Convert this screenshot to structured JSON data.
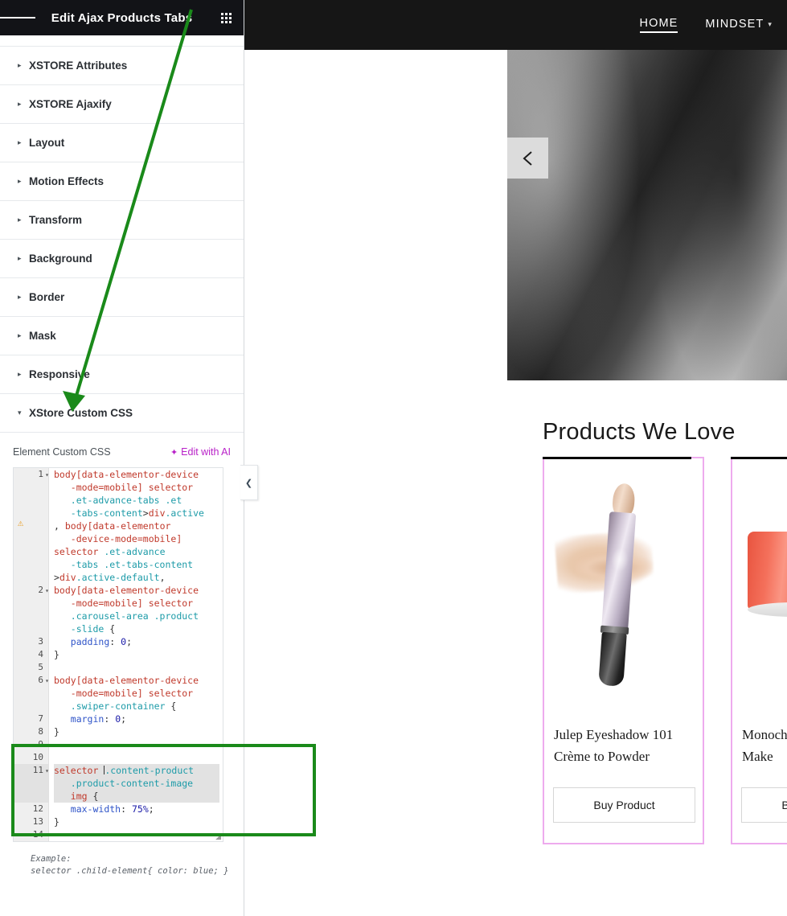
{
  "panel": {
    "title": "Edit Ajax Products Tabs",
    "menu_icon": "hamburger-icon",
    "apps_icon": "grid-icon",
    "sections": [
      {
        "label": "XSTORE Attributes",
        "expanded": false
      },
      {
        "label": "XSTORE Ajaxify",
        "expanded": false
      },
      {
        "label": "Layout",
        "expanded": false
      },
      {
        "label": "Motion Effects",
        "expanded": false
      },
      {
        "label": "Transform",
        "expanded": false
      },
      {
        "label": "Background",
        "expanded": false
      },
      {
        "label": "Border",
        "expanded": false
      },
      {
        "label": "Mask",
        "expanded": false
      },
      {
        "label": "Responsive",
        "expanded": false
      },
      {
        "label": "XStore Custom CSS",
        "expanded": true
      }
    ],
    "custom_css": {
      "field_label": "Element Custom CSS",
      "edit_with_ai": "Edit with AI",
      "warning_line": 1,
      "example_label": "Example:",
      "example_code": "selector .child-element{ color: blue; }",
      "lines": [
        {
          "n": "1",
          "fold": true
        },
        {
          "n": "2",
          "fold": true
        },
        {
          "n": "3"
        },
        {
          "n": "4"
        },
        {
          "n": "5"
        },
        {
          "n": "6",
          "fold": true
        },
        {
          "n": "7"
        },
        {
          "n": "8"
        },
        {
          "n": "9"
        },
        {
          "n": "10"
        },
        {
          "n": "11",
          "fold": true
        },
        {
          "n": "12"
        },
        {
          "n": "13"
        },
        {
          "n": "14"
        }
      ],
      "code_text": "body[data-elementor-device-mode=mobile] selector .et-advance-tabs .et-tabs-content>div.active, body[data-elementor-device-mode=mobile] selector .et-advance-tabs .et-tabs-content>div.active-default,\nbody[data-elementor-device-mode=mobile] selector .carousel-area .product-slide {\npadding: 0;\n}\n\nbody[data-elementor-device-mode=mobile] selector .swiper-container {\nmargin: 0;\n}\n\n\nselector .content-product .product-content-image img {\nmax-width: 75%;\n}\n",
      "collapse_handle_icon": "chevron-left-icon"
    }
  },
  "preview": {
    "nav": [
      {
        "label": "HOME",
        "active": true,
        "has_caret": false
      },
      {
        "label": "MINDSET",
        "active": false,
        "has_caret": true
      }
    ],
    "carousel_prev_icon": "chevron-left-icon",
    "section_title": "Products We Love",
    "products": [
      {
        "title": "Julep Eyeshadow 101 Crème to Powder",
        "button": "Buy Product",
        "image": "eyeshadow-stick-image"
      },
      {
        "title": "Monochromatic Use Make",
        "button": "Buy Product",
        "image": "red-cap-product-image"
      }
    ]
  },
  "annotation": {
    "box_color": "#1a8a1a",
    "arrow_color": "#1a8a1a",
    "arrow_points_to": "XStore Custom CSS"
  }
}
